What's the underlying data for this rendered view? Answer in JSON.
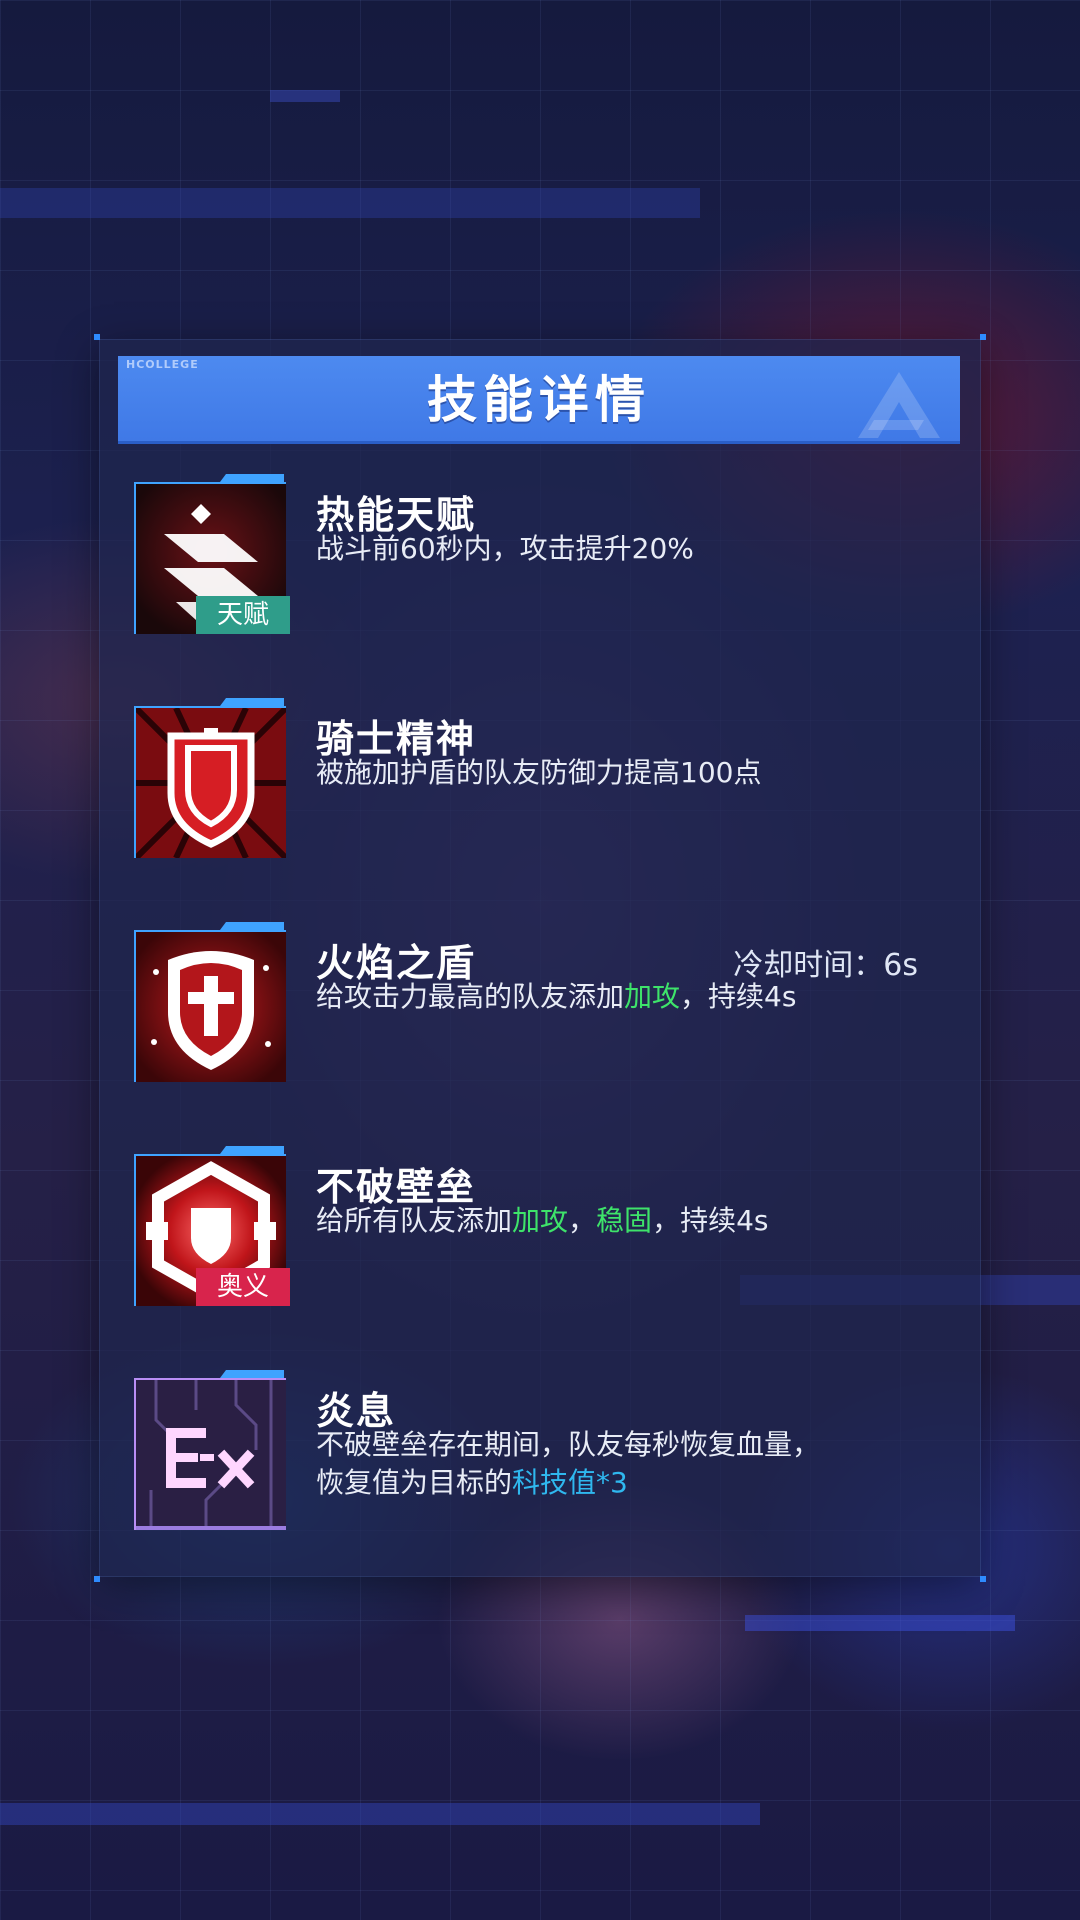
{
  "panel": {
    "brand": "HCOLLEGE",
    "title": "技能详情"
  },
  "skills": [
    {
      "name": "热能天赋",
      "badge": "天赋",
      "icon": "talent-stripes-icon",
      "desc": "战斗前60秒内，攻击提升20%"
    },
    {
      "name": "骑士精神",
      "icon": "knight-shield-icon",
      "desc": "被施加护盾的队友防御力提高100点"
    },
    {
      "name": "火焰之盾",
      "icon": "flame-shield-icon",
      "cooldown": "冷却时间：6s",
      "desc_parts": [
        "给攻击力最高的队友添加",
        "加攻",
        "，持续4s"
      ]
    },
    {
      "name": "不破壁垒",
      "badge": "奥义",
      "icon": "barrier-icon",
      "desc_parts": [
        "给所有队友添加",
        "加攻",
        "，",
        "稳固",
        "，持续4s"
      ]
    },
    {
      "name": "炎息",
      "icon": "ex-circuit-icon",
      "desc_line1": "不破壁垒存在期间，队友每秒恢复血量，",
      "desc_line2_parts": [
        "恢复值为目标的",
        "科技值*3"
      ]
    }
  ],
  "colors": {
    "title_bar": "#4580ea",
    "highlight_green": "#3ee36a",
    "highlight_cyan": "#2fb8ef",
    "badge_talent": "#2f9d8a",
    "badge_ultimate": "#d8244c"
  }
}
